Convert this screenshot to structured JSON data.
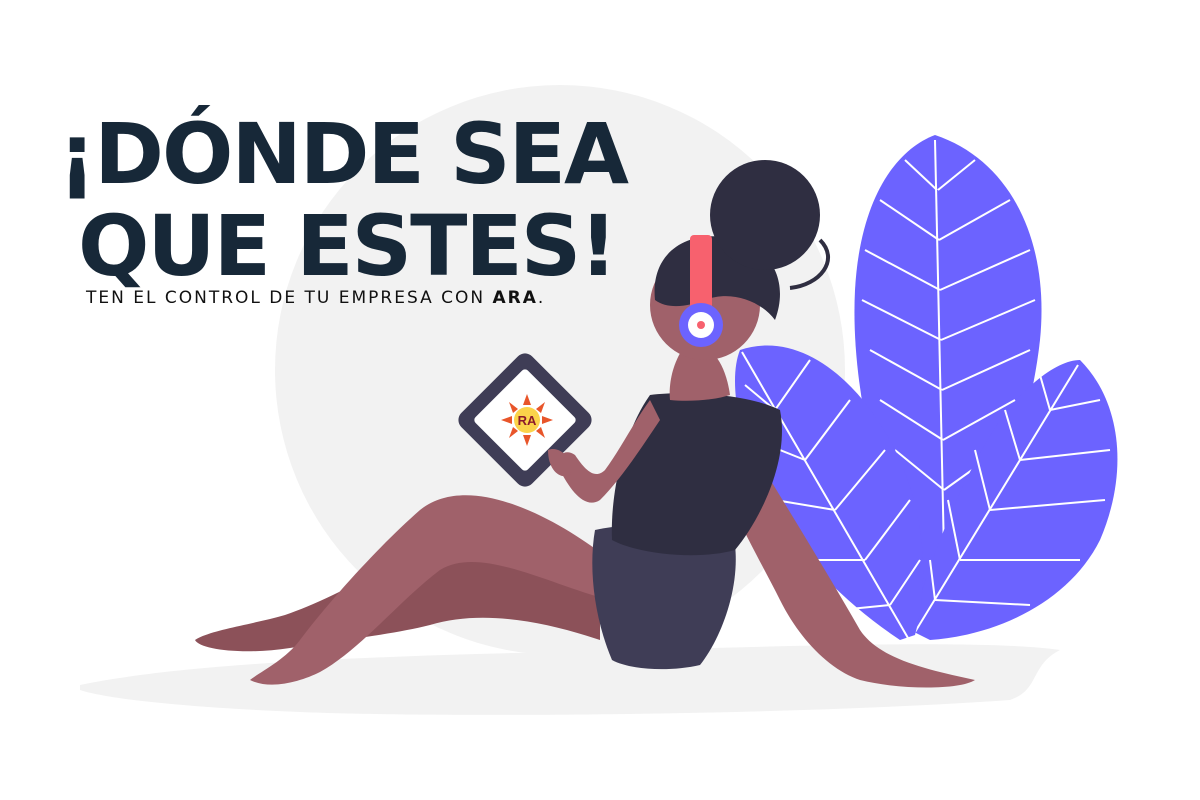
{
  "headline": {
    "line1": "¡DÓNDE SEA",
    "line2": "QUE ESTES!"
  },
  "subheadline": {
    "prefix": "TEN EL CONTROL DE TU EMPRESA CON ",
    "brand": "ARA",
    "suffix": "."
  },
  "tablet": {
    "logo_text": "RA"
  },
  "colors": {
    "headline": "#172838",
    "leaf": "#6c63ff",
    "skin": "#a0616a",
    "hair": "#2f2e41",
    "headphones": "#f7616e",
    "backdrop": "#f2f2f2"
  },
  "icons": [
    "ara-logo-icon",
    "headphones-icon",
    "leaf-illustration",
    "person-illustration"
  ]
}
